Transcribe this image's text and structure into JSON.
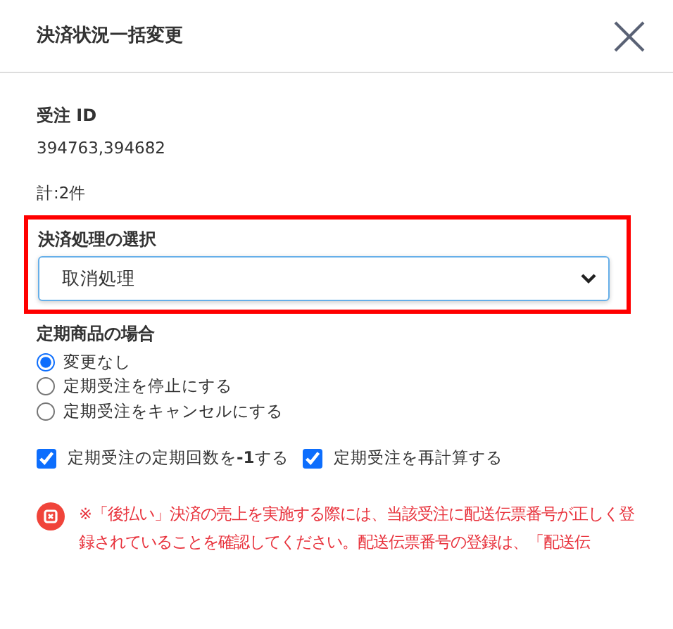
{
  "modal": {
    "title": "決済状況一括変更"
  },
  "order_ids": {
    "label": "受注 ID",
    "value": "394763,394682",
    "total": "計:2件"
  },
  "payment_process": {
    "label": "決済処理の選択",
    "value": "取消処理",
    "highlighted": true
  },
  "subscription": {
    "label": "定期商品の場合",
    "options": [
      {
        "label": "変更なし",
        "selected": true
      },
      {
        "label": "定期受注を停止にする",
        "selected": false
      },
      {
        "label": "定期受注をキャンセルにする",
        "selected": false
      }
    ]
  },
  "checkboxes": [
    {
      "label": "定期受注の定期回数を**-1**する",
      "checked": true
    },
    {
      "label": "定期受注を再計算する",
      "checked": true
    }
  ],
  "warning": {
    "text": "※「後払い」決済の売上を実施する際には、当該受注に配送伝票番号が正しく登録されていることを確認してください。配送伝票番号の登録は、「配送伝"
  }
}
